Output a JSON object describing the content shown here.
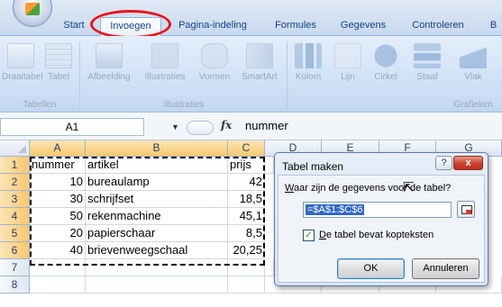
{
  "ribbon_tabs": [
    "Start",
    "Invoegen",
    "Pagina-indeling",
    "Formules",
    "Gegevens",
    "Controleren",
    "B"
  ],
  "active_tab": "Invoegen",
  "ribbon_buttons": [
    "Draaitabel",
    "Tabel",
    "Afbeelding",
    "Illustraties",
    "Vormen",
    "SmartArt",
    "Kolom",
    "Lijn",
    "Cirkel",
    "Staaf",
    "Vlak"
  ],
  "ribbon_groups": [
    "Tabellen",
    "Illustraties",
    "Grafieken"
  ],
  "formula_bar": {
    "name_box": "A1",
    "fx": "fx",
    "value": "nummer"
  },
  "columns": [
    "A",
    "B",
    "C",
    "D",
    "E",
    "F",
    "G"
  ],
  "rows": [
    "1",
    "2",
    "3",
    "4",
    "5",
    "6",
    "7",
    "8"
  ],
  "cells": [
    [
      "nummer",
      "artikel",
      "prijs"
    ],
    [
      "10",
      "bureaulamp",
      "42"
    ],
    [
      "30",
      "schrijfset",
      "18,5"
    ],
    [
      "50",
      "rekenmachine",
      "45,1"
    ],
    [
      "20",
      "papierschaar",
      "8,5"
    ],
    [
      "40",
      "brievenweegschaal",
      "20,25"
    ]
  ],
  "dialog": {
    "title": "Tabel maken",
    "help": "?",
    "close": "x",
    "question_pre": "",
    "question_ul": "W",
    "question_post": "aar zijn de gegevens voor de tabel?",
    "range_value": "=$A$1:$C$6",
    "checkbox_ul": "D",
    "checkbox_post": "e tabel bevat kopteksten",
    "checkbox_checked": "✓",
    "ok_label": "OK",
    "cancel_label": "Annuleren"
  },
  "colors": {
    "accent_red": "#e8141c",
    "selection": "#3169c6"
  }
}
